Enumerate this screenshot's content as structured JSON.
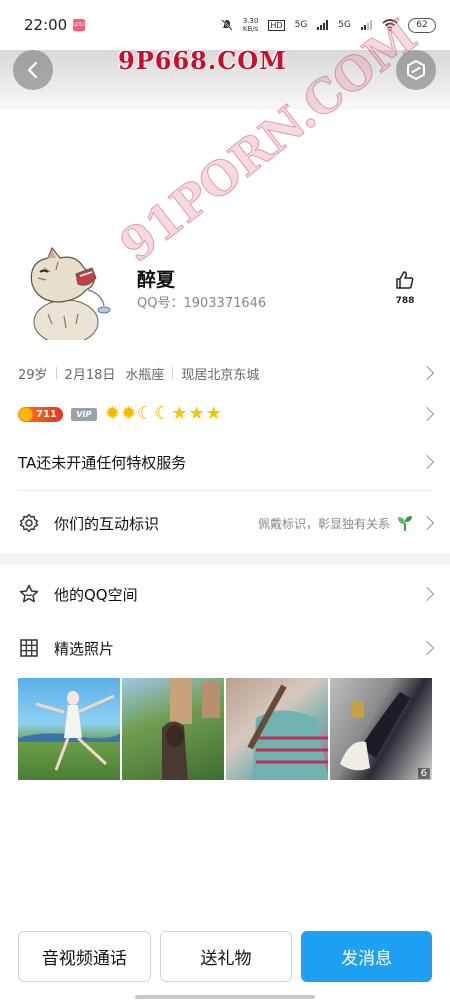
{
  "status_bar": {
    "time": "22:00",
    "app_badge": "LOLO",
    "net_speed_value": "3.30",
    "net_speed_unit": "KB/s",
    "hd": "HD",
    "network_1": "5G",
    "network_2": "5G",
    "battery": "62"
  },
  "watermarks": {
    "top": "9P668.COM",
    "diagonal": "91PORN.COM"
  },
  "profile": {
    "nickname": "醉夏",
    "qq_number": "QQ号：1903371646",
    "likes": "788"
  },
  "info": {
    "age": "29岁",
    "birthday": "2月18日",
    "zodiac": "水瓶座",
    "location": "现居北京东城"
  },
  "badges": {
    "coin_count": "711",
    "vip_label": "VIP",
    "levels": [
      "sun",
      "sun",
      "moon",
      "moon",
      "star",
      "star",
      "star"
    ]
  },
  "privilege": {
    "text": "TA还未开通任何特权服务"
  },
  "interaction": {
    "label": "你们的互动标识",
    "hint": "佩戴标识，彰显独有关系"
  },
  "menu": {
    "qzone": "他的QQ空间",
    "photos": "精选照片"
  },
  "photos": {
    "count_badge": "6"
  },
  "actions": {
    "call": "音视频通话",
    "gift": "送礼物",
    "message": "发消息"
  },
  "colors": {
    "primary_button": "#1ea1f2",
    "coin_badge": "#e8321e",
    "level_icons": "#f5b800"
  }
}
